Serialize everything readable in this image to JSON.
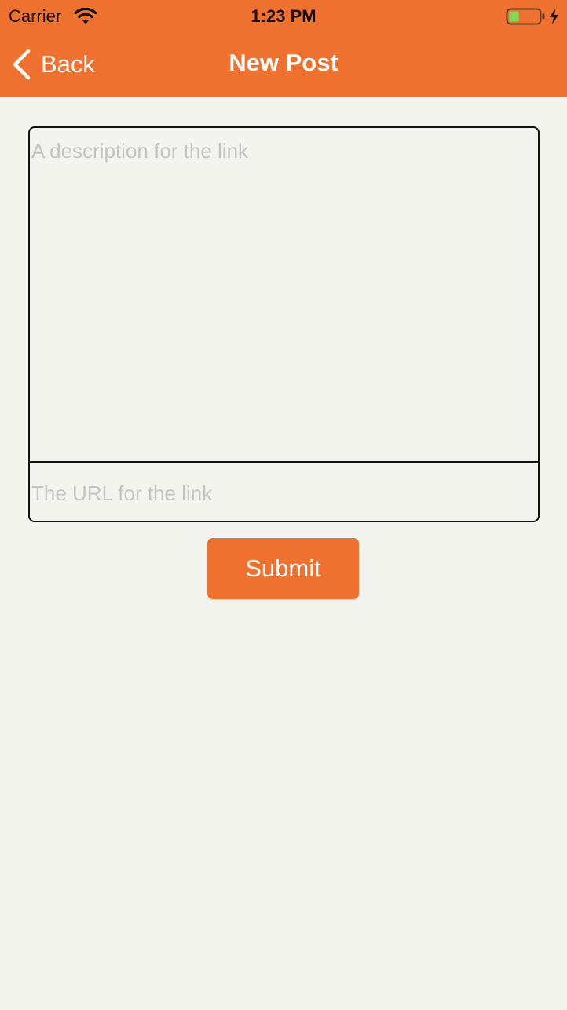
{
  "status_bar": {
    "carrier": "Carrier",
    "time": "1:23 PM",
    "wifi_icon": "wifi-icon",
    "battery_icon": "battery-charging-icon"
  },
  "nav_bar": {
    "back_label": "Back",
    "back_icon": "chevron-left-icon",
    "title": "New Post"
  },
  "form": {
    "description": {
      "value": "",
      "placeholder": "A description for the link"
    },
    "url": {
      "value": "",
      "placeholder": "The URL for the link"
    },
    "submit_label": "Submit"
  },
  "colors": {
    "accent": "#ef7130",
    "background": "#f4f4ef",
    "placeholder": "#c4c4c4",
    "battery_level": "#7ed957"
  }
}
